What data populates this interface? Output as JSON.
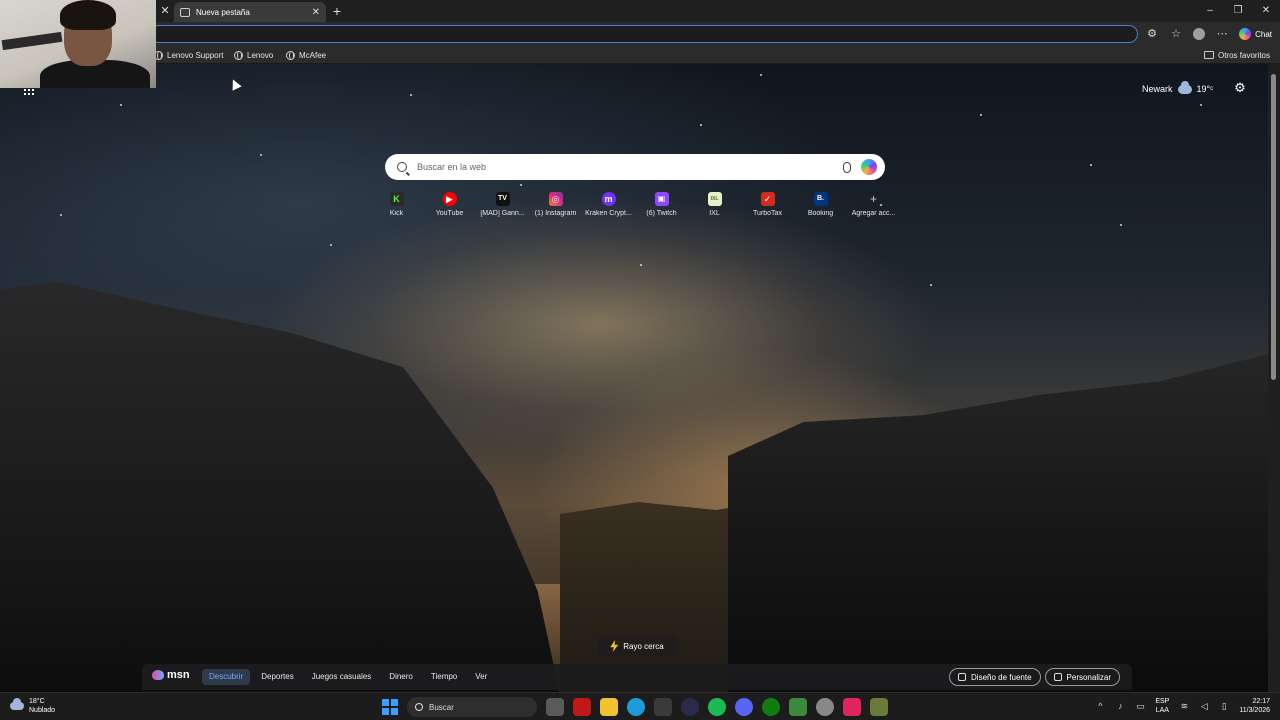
{
  "browser": {
    "tab_title": "Nueva pestaña",
    "tab_close": "✕",
    "prev_tab_close": "✕",
    "new_tab": "+",
    "window_controls": [
      "–",
      "❐",
      "✕"
    ],
    "address_value": "",
    "chat_label": "Chat",
    "favorites": [
      "Lenovo Support",
      "Lenovo",
      "McAfee"
    ],
    "other_favorites": "Otros favoritos"
  },
  "newtab": {
    "weather_city": "Newark",
    "weather_temp": "19°ᶜ",
    "search_placeholder": "Buscar en la web",
    "quick_links": [
      {
        "label": "Kick",
        "glyph": "K",
        "color": "#2a2a2a",
        "fg": "#53fc18"
      },
      {
        "label": "YouTube",
        "glyph": "▶",
        "color": "#ff0000",
        "fg": "#ffffff"
      },
      {
        "label": "[MAD] Gann...",
        "glyph": "TV",
        "color": "#111111",
        "fg": "#ffffff"
      },
      {
        "label": "(1) Instagram",
        "glyph": "◎",
        "color": "#d6249f",
        "fg": "#ffffff"
      },
      {
        "label": "Kraken Crypt...",
        "glyph": "m",
        "color": "#7132f5",
        "fg": "#ffffff"
      },
      {
        "label": "(6) Twitch",
        "glyph": "▣",
        "color": "#9146ff",
        "fg": "#ffffff"
      },
      {
        "label": "IXL",
        "glyph": "IXL",
        "color": "#e8f0c8",
        "fg": "#2d7a2d"
      },
      {
        "label": "TurboTax",
        "glyph": "✓",
        "color": "#d52b1e",
        "fg": "#ffffff"
      },
      {
        "label": "Booking",
        "glyph": "B.",
        "color": "#003580",
        "fg": "#ffffff"
      },
      {
        "label": "Agregar acc...",
        "glyph": "+",
        "color": "transparent",
        "fg": "#cccccc"
      }
    ],
    "rayo": "Rayo cerca"
  },
  "msn": {
    "logo": "msn",
    "nav": [
      "Descubrir",
      "Deportes",
      "Juegos casuales",
      "Dinero",
      "Tiempo",
      "Ver"
    ],
    "active_nav": "Descubrir",
    "font_button": "Diseño de fuente",
    "personalize_button": "Personalizar"
  },
  "taskbar": {
    "weather_temp": "18°C",
    "weather_desc": "Nublado",
    "search_label": "Buscar",
    "apps": [
      {
        "name": "task-view",
        "color": "#5a5a5a"
      },
      {
        "name": "mcafee",
        "color": "#c01818"
      },
      {
        "name": "file-explorer",
        "color": "#f2c230"
      },
      {
        "name": "edge",
        "color": "#1e9bd7"
      },
      {
        "name": "store",
        "color": "#3a3a3a"
      },
      {
        "name": "obs",
        "color": "#2a2a4a"
      },
      {
        "name": "spotify",
        "color": "#1db954"
      },
      {
        "name": "discord",
        "color": "#5865f2"
      },
      {
        "name": "xbox",
        "color": "#107c10"
      },
      {
        "name": "minecraft",
        "color": "#3c8a3c"
      },
      {
        "name": "chrome",
        "color": "#888888"
      },
      {
        "name": "tiktok",
        "color": "#e0245e"
      },
      {
        "name": "minecraft-launcher",
        "color": "#6a7a3a"
      }
    ],
    "lang_top": "ESP",
    "lang_bottom": "LAA",
    "time": "22:17",
    "date": "11/3/2026"
  }
}
